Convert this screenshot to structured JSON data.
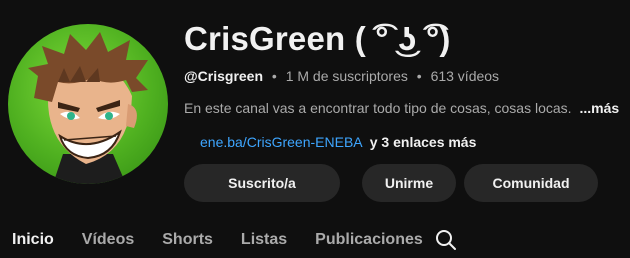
{
  "channel": {
    "name": "CrisGreen ( ͡° ͜ʖ ͡°)",
    "handle": "@Crisgreen",
    "separator": "•",
    "subscribers": "1 M de suscriptores",
    "videos": "613 vídeos",
    "description": "En este canal vas a encontrar todo tipo de cosas, cosas locas.",
    "more_label": "...más",
    "link_text": "ene.ba/CrisGreen-ENEBA",
    "more_links": "y 3 enlaces más"
  },
  "buttons": {
    "subscribed": "Suscrito/a",
    "join": "Unirme",
    "community": "Comunidad"
  },
  "tabs": [
    {
      "label": "Inicio",
      "active": true
    },
    {
      "label": "Vídeos",
      "active": false
    },
    {
      "label": "Shorts",
      "active": false
    },
    {
      "label": "Listas",
      "active": false
    },
    {
      "label": "Publicaciones",
      "active": false
    }
  ],
  "icons": {
    "search": "search-icon",
    "avatar": "avatar-character"
  },
  "colors": {
    "background": "#0f0f0f",
    "text_primary": "#f1f1f1",
    "text_secondary": "#aaaaaa",
    "link": "#3ea6ff",
    "button_bg": "#272727",
    "avatar_green": "#4fb020"
  }
}
